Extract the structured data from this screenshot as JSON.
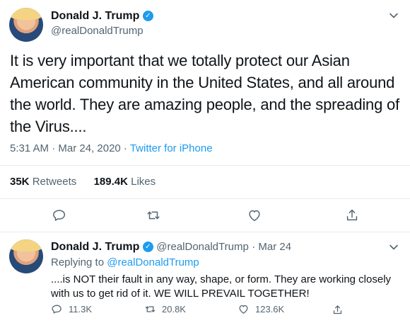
{
  "main_tweet": {
    "author_name": "Donald J. Trump",
    "author_handle": "@realDonaldTrump",
    "text": "It is very important that we totally protect our Asian American community in the United States, and all around the world. They are amazing people, and the spreading of the Virus....",
    "time": "5:31 AM · Mar 24, 2020 · ",
    "source": "Twitter for iPhone",
    "retweets_count": "35K",
    "retweets_label": "Retweets",
    "likes_count": "189.4K",
    "likes_label": "Likes",
    "icons": [
      "reply-icon",
      "retweet-icon",
      "like-icon",
      "share-icon",
      "chevron-down-icon"
    ]
  },
  "reply_tweet": {
    "author_name": "Donald J. Trump",
    "author_handle": "@realDonaldTrump",
    "date": "· Mar 24",
    "replying_prefix": "Replying to ",
    "replying_handle": "@realDonaldTrump",
    "text": "....is NOT their fault in any way, shape, or form. They are working closely with us to get rid of it. WE WILL PREVAIL TOGETHER!",
    "reply_count": "11.3K",
    "retweet_count": "20.8K",
    "like_count": "123.6K"
  },
  "colors": {
    "accent": "#1d9bf0",
    "text": "#0f1419",
    "muted": "#536471",
    "divider": "#e7ebef"
  }
}
